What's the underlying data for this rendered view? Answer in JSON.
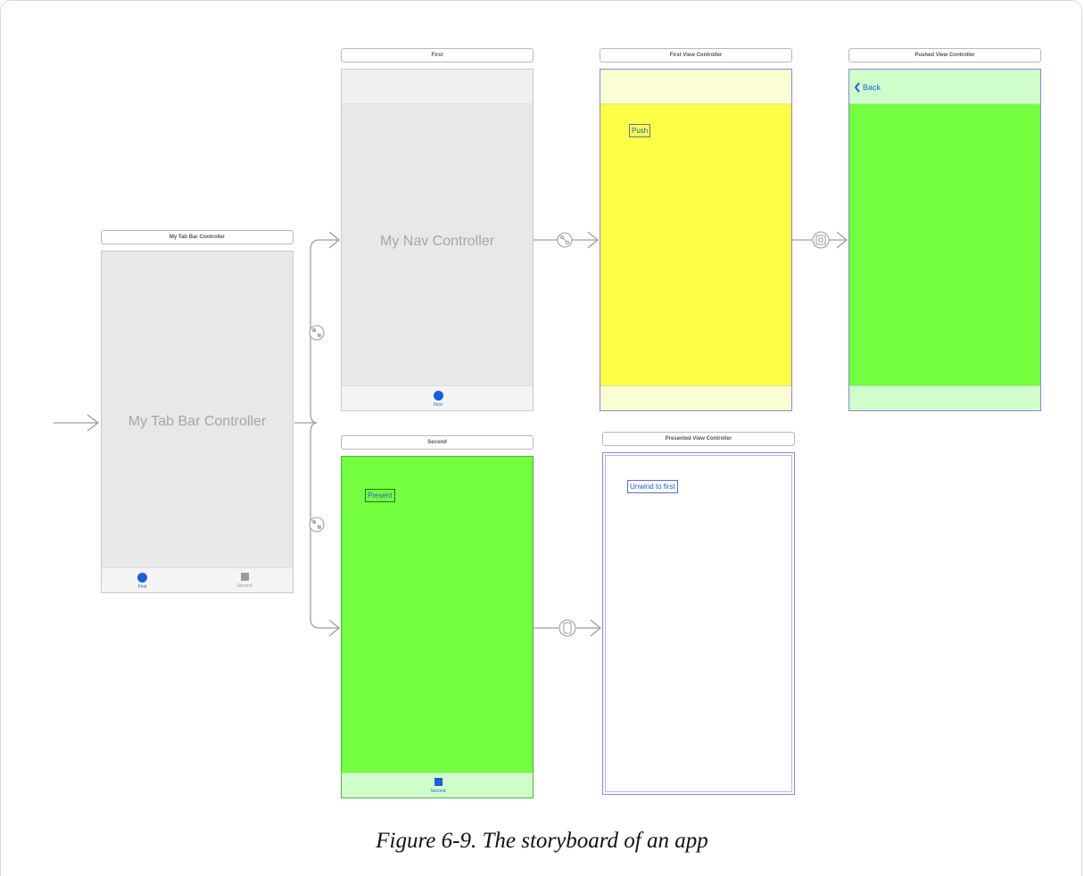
{
  "caption": "Figure 6-9. The storyboard of an app",
  "scenes": {
    "tab_bar": {
      "title": "My Tab Bar Controller",
      "label": "My Tab Bar Controller",
      "tabs": [
        {
          "label": "First",
          "icon": "circle-icon"
        },
        {
          "label": "Second",
          "icon": "square-icon"
        }
      ]
    },
    "nav": {
      "title": "First",
      "label": "My Nav Controller",
      "tab_label": "First"
    },
    "first_vc": {
      "title": "First View Controller",
      "button": "Push",
      "color": "#fdff46"
    },
    "pushed_vc": {
      "title": "Pushed View Controller",
      "back": "Back",
      "color": "#74ff3f"
    },
    "second": {
      "title": "Second",
      "button": "Present",
      "tab_label": "Second",
      "color": "#74ff3f"
    },
    "presented_vc": {
      "title": "Presented View Controller",
      "button": "Unwind to first"
    }
  }
}
